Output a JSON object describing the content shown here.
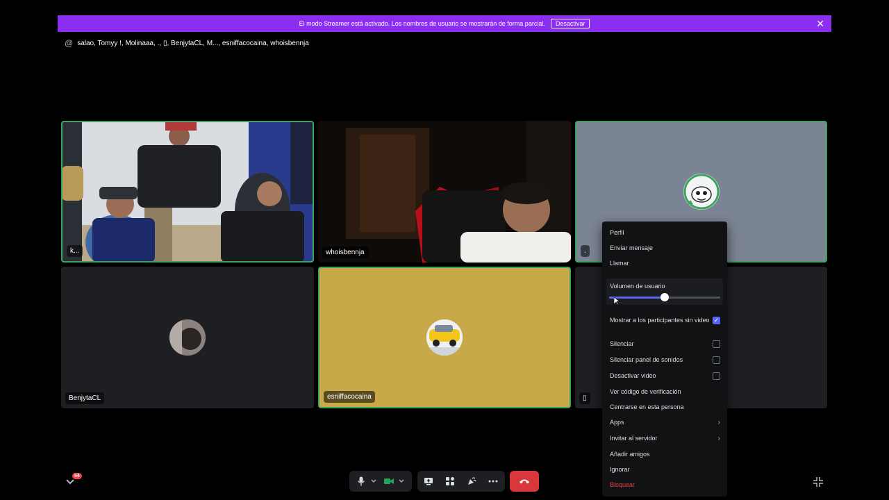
{
  "banner": {
    "text": "El modo Streamer está activado. Los nombres de usuario se mostrarán de forma parcial.",
    "button_label": "Desactivar",
    "close_label": "✕",
    "color": "#8c2ef2"
  },
  "header": {
    "at_symbol": "@",
    "participants_text": "salao, Tomyy !, Molinaaa, ., ▯, BenjytaCL, M..., esniffacocaina, whoisbennja"
  },
  "tiles": {
    "t1_name": "k...",
    "t2_name": "whoisbennja",
    "t3_name": ".",
    "t4_name": "BenjytaCL",
    "t5_name": "esniffacocaina",
    "t6_name": "▯"
  },
  "context_menu": {
    "profile": "Perfil",
    "send_message": "Enviar mensaje",
    "call": "Llamar",
    "user_volume": "Volumen de usuario",
    "user_volume_level": 0.5,
    "show_no_video": "Mostrar a los participantes sin video",
    "show_no_video_checked": true,
    "mute": "Silenciar",
    "mute_soundboard": "Silenciar panel de sonidos",
    "disable_video": "Desactivar video",
    "verification_code": "Ver código de verificación",
    "focus_person": "Centrarse en esta persona",
    "apps": "Apps",
    "invite_server": "Invitar al servidor",
    "add_friends": "Añadir amigos",
    "ignore": "Ignorar",
    "block": "Bloquear"
  },
  "bottom": {
    "notification_count": "54"
  },
  "colors": {
    "accent": "#5865f2",
    "speaking_border": "#3ba55d",
    "danger": "#f23f42",
    "hangup": "#da373c",
    "tile_yellow": "#c8a94a",
    "tile_gray": "#7b8494"
  }
}
